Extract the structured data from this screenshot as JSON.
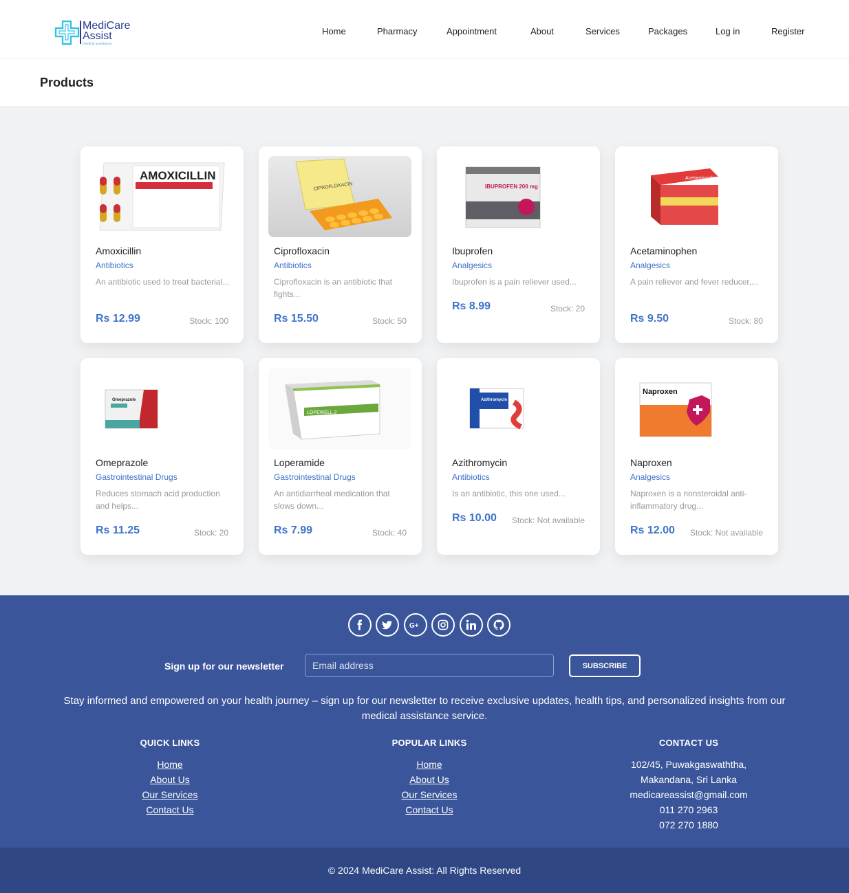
{
  "brand": {
    "line1": "MediCare",
    "line2": "Assist",
    "tagline": "medical assistance"
  },
  "nav": {
    "items": [
      "Home",
      "Pharmacy",
      "Appointment",
      "About",
      "Services",
      "Packages",
      "Log in",
      "Register"
    ]
  },
  "page": {
    "title": "Products"
  },
  "products": [
    {
      "name": "Amoxicillin",
      "category": "Antibiotics",
      "description": "An antibiotic used to treat bacterial...",
      "price": "Rs 12.99",
      "stock": "Stock: 100",
      "package_text": "AMOXICILLIN"
    },
    {
      "name": "Ciprofloxacin",
      "category": "Antibiotics",
      "description": "Ciprofloxacin is an antibiotic that fights...",
      "price": "Rs 15.50",
      "stock": "Stock: 50",
      "package_text": "CIPROFLOXACIN"
    },
    {
      "name": "Ibuprofen",
      "category": "Analgesics",
      "description": "Ibuprofen is a pain reliever used...",
      "price": "Rs 8.99",
      "stock": "Stock: 20",
      "package_text": "IBUPROFEN 200 mg"
    },
    {
      "name": "Acetaminophen",
      "category": "Analgesics",
      "description": "A pain reliever and fever reducer,...",
      "price": "Rs 9.50",
      "stock": "Stock: 80",
      "package_text": "Acetaminophen"
    },
    {
      "name": "Omeprazole",
      "category": "Gastrointestinal Drugs",
      "description": "Reduces stomach acid production and helps...",
      "price": "Rs 11.25",
      "stock": "Stock: 20",
      "package_text": "Omeprazole"
    },
    {
      "name": "Loperamide",
      "category": "Gastrointestinal Drugs",
      "description": "An antidiarrheal medication that slows down...",
      "price": "Rs 7.99",
      "stock": "Stock: 40",
      "package_text": "LOPEWELL 2"
    },
    {
      "name": "Azithromycin",
      "category": "Antibiotics",
      "description": "Is an antibiotic, this one used...",
      "price": "Rs 10.00",
      "stock": "Stock: Not available",
      "package_text": "Azithromycin 500 mg"
    },
    {
      "name": "Naproxen",
      "category": "Analgesics",
      "description": "Naproxen is a nonsteroidal anti-inflammatory drug...",
      "price": "Rs 12.00",
      "stock": "Stock: Not available",
      "package_text": "Naproxen"
    }
  ],
  "footer": {
    "social": [
      "facebook-icon",
      "twitter-icon",
      "google-plus-icon",
      "instagram-icon",
      "linkedin-icon",
      "github-icon"
    ],
    "newsletter_label": "Sign up for our newsletter",
    "email_placeholder": "Email address",
    "subscribe_label": "SUBSCRIBE",
    "blurb": "Stay informed and empowered on your health journey – sign up for our newsletter to receive exclusive updates, health tips, and personalized insights from our medical assistance service.",
    "quick_links": {
      "title": "QUICK LINKS",
      "items": [
        "Home",
        "About Us",
        "Our Services",
        "Contact Us"
      ]
    },
    "popular_links": {
      "title": "POPULAR LINKS",
      "items": [
        "Home",
        "About Us",
        "Our Services",
        "Contact Us"
      ]
    },
    "contact": {
      "title": "CONTACT US",
      "items": [
        "102/45, Puwakgaswaththa,",
        "Makandana, Sri Lanka",
        "medicareassist@gmail.com",
        "011 270 2963",
        "072 270 1880"
      ]
    },
    "copyright": "© 2024 MediCare Assist: All Rights Reserved"
  },
  "colors": {
    "accent": "#3f73c9",
    "footer": "#3a5599",
    "footer_bottom": "#2f4785",
    "page_bg": "#f1f2f4"
  }
}
